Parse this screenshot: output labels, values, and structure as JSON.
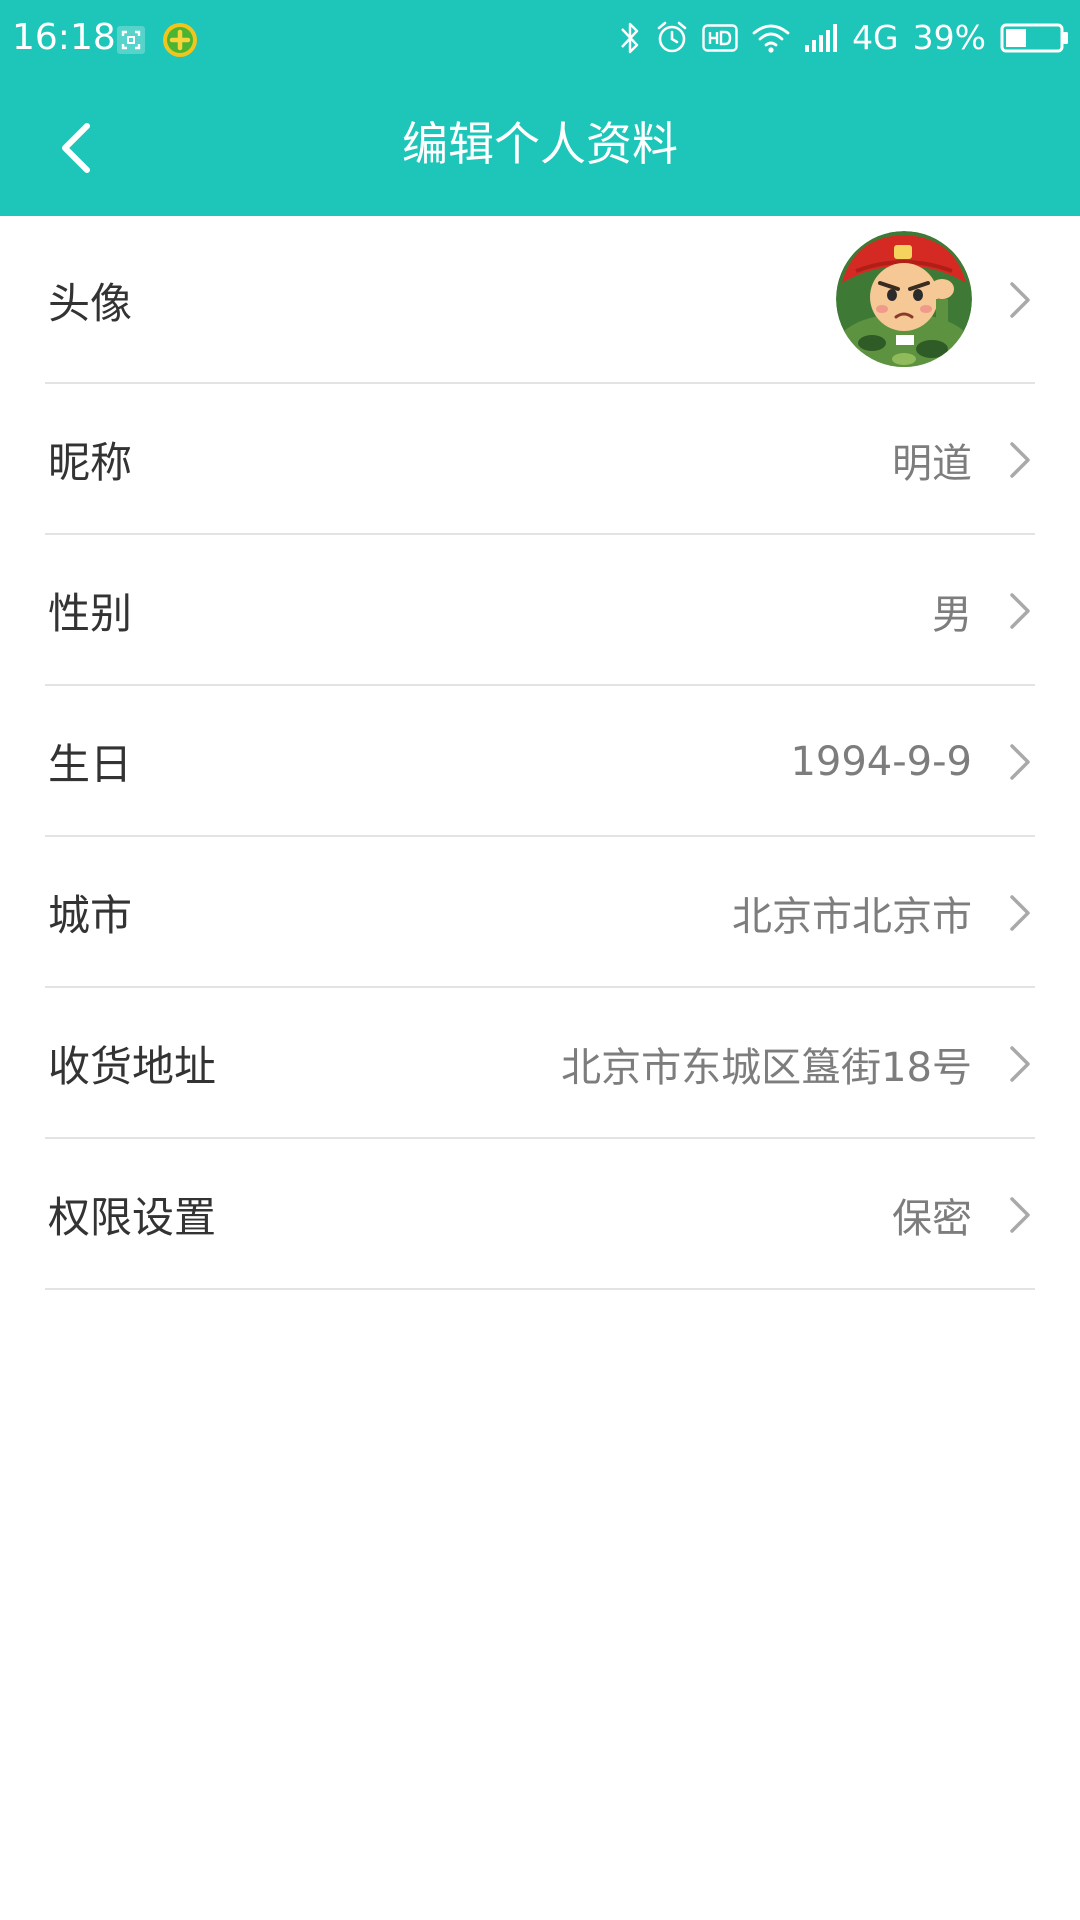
{
  "status_bar": {
    "time": "16:18",
    "network": "4G",
    "battery": "39%",
    "battery_level": 0.39,
    "icons": [
      "screenshot-icon",
      "app-360-icon",
      "bluetooth-icon",
      "alarm-icon",
      "hd-icon",
      "wifi-icon",
      "signal-icon",
      "battery-icon"
    ]
  },
  "header": {
    "title": "编辑个人资料",
    "back_icon": "chevron-left-icon"
  },
  "colors": {
    "accent": "#1ec5b9",
    "label": "#333333",
    "value": "#7d7d7d",
    "divider": "#e3e3e3",
    "chevron": "#a9a9a9"
  },
  "profile": {
    "avatar": {
      "label": "头像"
    },
    "nickname": {
      "label": "昵称",
      "value": "明道"
    },
    "gender": {
      "label": "性别",
      "value": "男"
    },
    "birthday": {
      "label": "生日",
      "value": "1994-9-9"
    },
    "city": {
      "label": "城市",
      "value": "北京市北京市"
    },
    "address": {
      "label": "收货地址",
      "value": "北京市东城区簋街18号"
    },
    "privacy": {
      "label": "权限设置",
      "value": "保密"
    }
  }
}
